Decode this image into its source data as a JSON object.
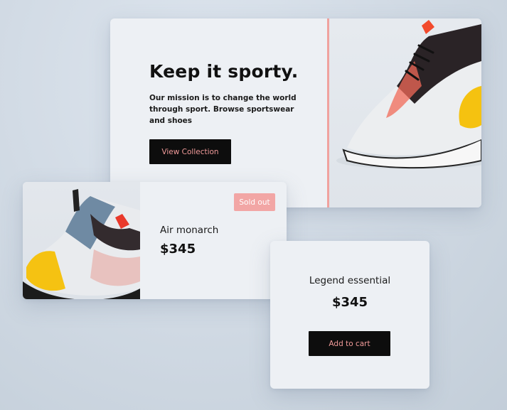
{
  "hero": {
    "title": "Keep it sporty.",
    "description": "Our mission is to change the world through sport. Browse sportswear and shoes",
    "button_label": "View Collection"
  },
  "products": [
    {
      "name": "Air monarch",
      "price": "$345",
      "badge": "Sold out"
    },
    {
      "name": "Legend essential",
      "price": "$345",
      "button_label": "Add to cart"
    }
  ],
  "colors": {
    "accent_pink": "#f0a29e",
    "button_bg": "#0d0d0d",
    "button_text": "#f09a99",
    "card_bg": "#edf0f4"
  },
  "icons": [
    "sneaker-image"
  ]
}
